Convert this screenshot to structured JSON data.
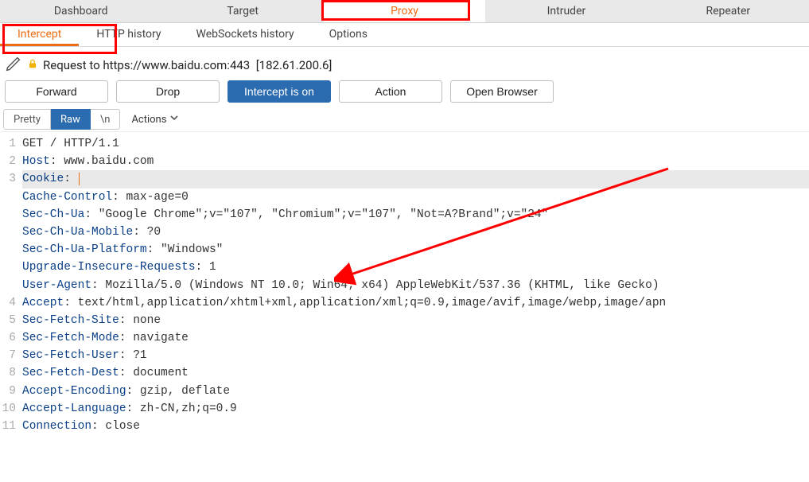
{
  "topTabs": {
    "dashboard": "Dashboard",
    "target": "Target",
    "proxy": "Proxy",
    "intruder": "Intruder",
    "repeater": "Repeater"
  },
  "subTabs": {
    "intercept": "Intercept",
    "httpHistory": "HTTP history",
    "wsHistory": "WebSockets history",
    "options": "Options"
  },
  "request": {
    "label_prefix": "Request to ",
    "url": "https://www.baidu.com:443",
    "ip": "[182.61.200.6]"
  },
  "buttons": {
    "forward": "Forward",
    "drop": "Drop",
    "intercept": "Intercept is on",
    "action": "Action",
    "openBrowser": "Open Browser"
  },
  "viewModes": {
    "pretty": "Pretty",
    "raw": "Raw",
    "newline": "\\n",
    "actions": "Actions"
  },
  "gutter": [
    "1",
    "2",
    "3",
    "",
    "",
    "",
    "",
    "",
    "",
    "4",
    "5",
    "6",
    "7",
    "8",
    "9",
    "10",
    "11"
  ],
  "editorLines": [
    {
      "type": "reqline",
      "text": "GET / HTTP/1.1"
    },
    {
      "type": "hdr",
      "name": "Host",
      "value": "www.baidu.com"
    },
    {
      "type": "hdr",
      "name": "Cookie",
      "value": "",
      "selected": true,
      "cursor": true
    },
    {
      "type": "hdr",
      "name": "Cache-Control",
      "value": "max-age=0"
    },
    {
      "type": "hdr",
      "name": "Sec-Ch-Ua",
      "value": "\"Google Chrome\";v=\"107\", \"Chromium\";v=\"107\", \"Not=A?Brand\";v=\"24\""
    },
    {
      "type": "hdr",
      "name": "Sec-Ch-Ua-Mobile",
      "value": "?0"
    },
    {
      "type": "hdr",
      "name": "Sec-Ch-Ua-Platform",
      "value": "\"Windows\""
    },
    {
      "type": "hdr",
      "name": "Upgrade-Insecure-Requests",
      "value": "1"
    },
    {
      "type": "hdr",
      "name": "User-Agent",
      "value": "Mozilla/5.0 (Windows NT 10.0; Win64; x64) AppleWebKit/537.36 (KHTML, like Gecko)"
    },
    {
      "type": "hdr",
      "name": "Accept",
      "value": "text/html,application/xhtml+xml,application/xml;q=0.9,image/avif,image/webp,image/apn"
    },
    {
      "type": "hdr",
      "name": "Sec-Fetch-Site",
      "value": "none"
    },
    {
      "type": "hdr",
      "name": "Sec-Fetch-Mode",
      "value": "navigate"
    },
    {
      "type": "hdr",
      "name": "Sec-Fetch-User",
      "value": "?1"
    },
    {
      "type": "hdr",
      "name": "Sec-Fetch-Dest",
      "value": "document"
    },
    {
      "type": "hdr",
      "name": "Accept-Encoding",
      "value": "gzip, deflate"
    },
    {
      "type": "hdr",
      "name": "Accept-Language",
      "value": "zh-CN,zh;q=0.9"
    },
    {
      "type": "hdr",
      "name": "Connection",
      "value": "close"
    }
  ]
}
